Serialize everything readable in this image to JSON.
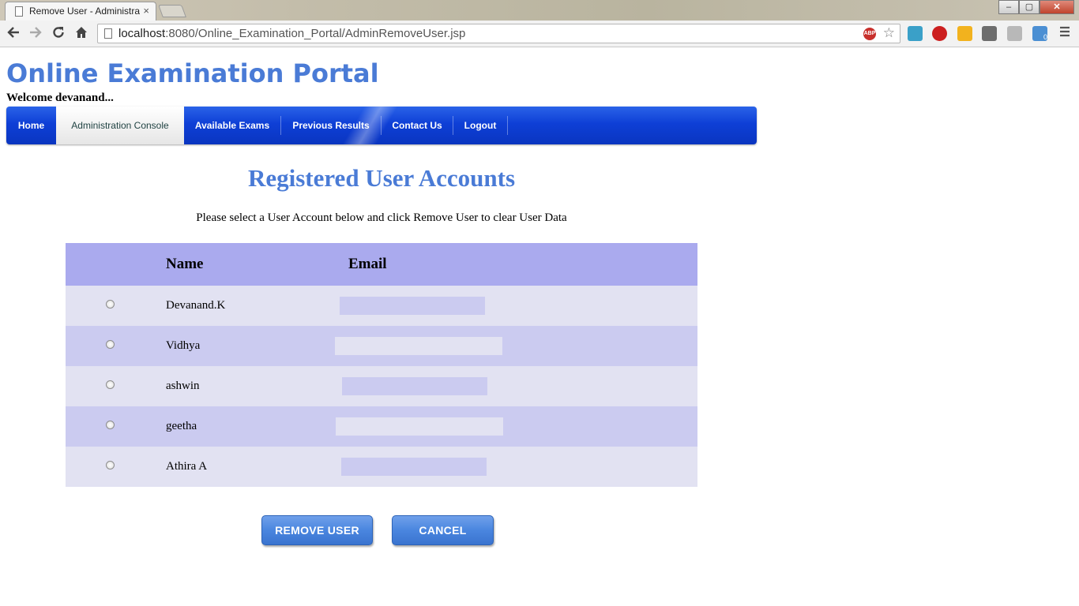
{
  "browser": {
    "tab_title": "Remove User - Administra",
    "tab_close": "×",
    "window_controls": {
      "minimize": "–",
      "maximize": "▢",
      "close": "✕"
    },
    "url_host": "localhost",
    "url_rest": ":8080/Online_Examination_Portal/AdminRemoveUser.jsp",
    "abp_badge": "ABP",
    "extension_count": "0"
  },
  "site": {
    "title": "Online Examination Portal",
    "welcome": "Welcome devanand..."
  },
  "menu": {
    "items": [
      {
        "label": "Home"
      },
      {
        "label": "Administration Console"
      },
      {
        "label": "Available Exams"
      },
      {
        "label": "Previous Results"
      },
      {
        "label": "Contact Us"
      },
      {
        "label": "Logout"
      }
    ],
    "active_index": 1
  },
  "main": {
    "heading": "Registered User Accounts",
    "instruction": "Please select a User Account below and click Remove User to clear User Data",
    "table": {
      "columns": [
        "",
        "Name",
        "Email"
      ],
      "rows": [
        {
          "name": "Devanand.K",
          "email": ""
        },
        {
          "name": "Vidhya",
          "email": ""
        },
        {
          "name": "ashwin",
          "email": ""
        },
        {
          "name": "geetha",
          "email": ""
        },
        {
          "name": "Athira A",
          "email": ""
        }
      ]
    },
    "buttons": {
      "remove": "REMOVE USER",
      "cancel": "CANCEL"
    }
  },
  "colors": {
    "brand_blue": "#4a7bd6",
    "menu_blue": "#0e3fd6",
    "table_header": "#aaaaee",
    "row_light": "#e2e2f2",
    "row_dark": "#cbcbf0"
  },
  "icons": {
    "back": "back-arrow-icon",
    "forward": "forward-arrow-icon",
    "reload": "reload-icon",
    "home": "home-icon",
    "bookmark": "star-icon"
  }
}
